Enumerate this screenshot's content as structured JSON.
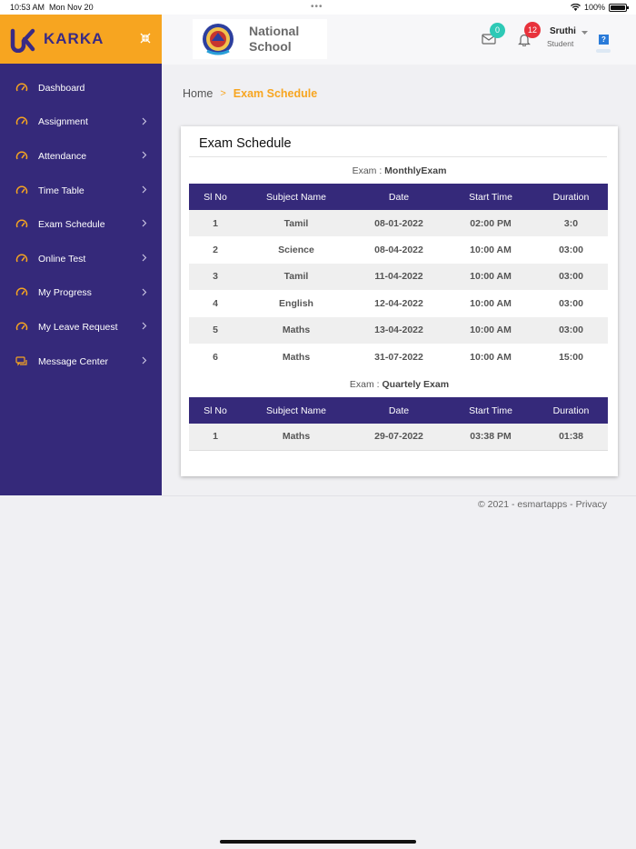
{
  "status_bar": {
    "time": "10:53 AM",
    "date": "Mon Nov 20",
    "dots": "•••",
    "battery": "100%"
  },
  "brand": {
    "name": "KARKA",
    "accent": "#f7a520",
    "nav_bg": "#35297a"
  },
  "sidebar": {
    "items": [
      {
        "label": "Dashboard",
        "icon": "gauge-icon",
        "has_chevron": false
      },
      {
        "label": "Assignment",
        "icon": "gauge-icon",
        "has_chevron": true
      },
      {
        "label": "Attendance",
        "icon": "gauge-icon",
        "has_chevron": true
      },
      {
        "label": "Time Table",
        "icon": "gauge-icon",
        "has_chevron": true
      },
      {
        "label": "Exam Schedule",
        "icon": "gauge-icon",
        "has_chevron": true
      },
      {
        "label": "Online Test",
        "icon": "gauge-icon",
        "has_chevron": true
      },
      {
        "label": "My Progress",
        "icon": "gauge-icon",
        "has_chevron": true
      },
      {
        "label": "My Leave Request",
        "icon": "gauge-icon",
        "has_chevron": true
      },
      {
        "label": "Message Center",
        "icon": "chat-icon",
        "has_chevron": true
      }
    ]
  },
  "header": {
    "school_line1": "National",
    "school_line2": "School",
    "mail_count": "0",
    "notification_count": "12",
    "user_name": "Sruthi",
    "user_role": "Student",
    "help_label": "?"
  },
  "breadcrumb": {
    "home": "Home",
    "separator": ">",
    "current": "Exam Schedule"
  },
  "main": {
    "title": "Exam Schedule",
    "columns": [
      "Sl No",
      "Subject Name",
      "Date",
      "Start Time",
      "Duration"
    ],
    "exams": [
      {
        "prefix": "Exam : ",
        "name": "MonthlyExam",
        "rows": [
          [
            "1",
            "Tamil",
            "08-01-2022",
            "02:00 PM",
            "3:0"
          ],
          [
            "2",
            "Science",
            "08-04-2022",
            "10:00 AM",
            "03:00"
          ],
          [
            "3",
            "Tamil",
            "11-04-2022",
            "10:00 AM",
            "03:00"
          ],
          [
            "4",
            "English",
            "12-04-2022",
            "10:00 AM",
            "03:00"
          ],
          [
            "5",
            "Maths",
            "13-04-2022",
            "10:00 AM",
            "03:00"
          ],
          [
            "6",
            "Maths",
            "31-07-2022",
            "10:00 AM",
            "15:00"
          ]
        ]
      },
      {
        "prefix": "Exam : ",
        "name": "Quartely Exam",
        "rows": [
          [
            "1",
            "Maths",
            "29-07-2022",
            "03:38 PM",
            "01:38"
          ]
        ]
      }
    ]
  },
  "footer": {
    "text": "© 2021 - esmartapps - Privacy"
  }
}
